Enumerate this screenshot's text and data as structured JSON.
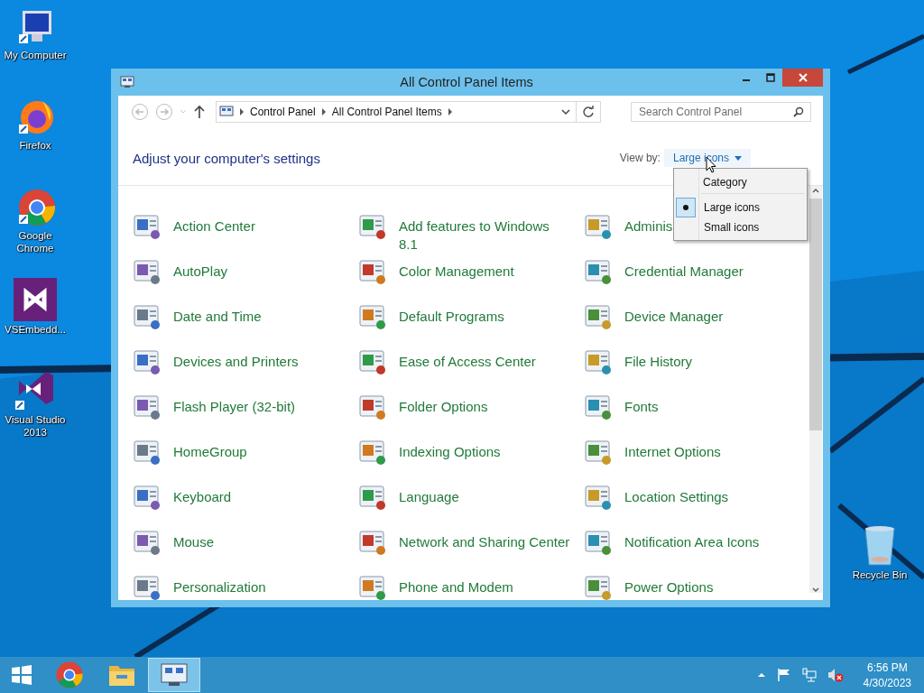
{
  "desktop_icons": [
    {
      "label": "My Computer",
      "kind": "computer"
    },
    {
      "label": "Firefox",
      "kind": "firefox"
    },
    {
      "label": "Google Chrome",
      "kind": "chrome"
    },
    {
      "label": "VSEmbedd...",
      "kind": "vs-tile"
    },
    {
      "label": "Visual Studio 2013",
      "kind": "vs"
    },
    {
      "label": "Recycle Bin",
      "kind": "bin"
    }
  ],
  "window": {
    "title": "All Control Panel Items",
    "address": [
      "Control Panel",
      "All Control Panel Items"
    ],
    "search": {
      "placeholder": "Search Control Panel"
    },
    "heading": "Adjust your computer's settings",
    "view_by": {
      "label": "View by:",
      "value": "Large icons"
    },
    "view_menu": [
      {
        "label": "Category",
        "selected": false
      },
      {
        "label": "Large icons",
        "selected": true
      },
      {
        "label": "Small icons",
        "selected": false
      }
    ],
    "items": [
      "Action Center",
      "Add features to Windows 8.1",
      "Adminis",
      "AutoPlay",
      "Color Management",
      "Credential Manager",
      "Date and Time",
      "Default Programs",
      "Device Manager",
      "Devices and Printers",
      "Ease of Access Center",
      "File History",
      "Flash Player (32-bit)",
      "Folder Options",
      "Fonts",
      "HomeGroup",
      "Indexing Options",
      "Internet Options",
      "Keyboard",
      "Language",
      "Location Settings",
      "Mouse",
      "Network and Sharing Center",
      "Notification Area Icons",
      "Personalization",
      "Phone and Modem",
      "Power Options"
    ]
  },
  "taskbar": {
    "apps": [
      {
        "kind": "chrome",
        "selected": false
      },
      {
        "kind": "explorer",
        "selected": false
      },
      {
        "kind": "control-panel",
        "selected": true
      }
    ],
    "clock": {
      "time": "6:56 PM",
      "date": "4/30/2023"
    }
  }
}
